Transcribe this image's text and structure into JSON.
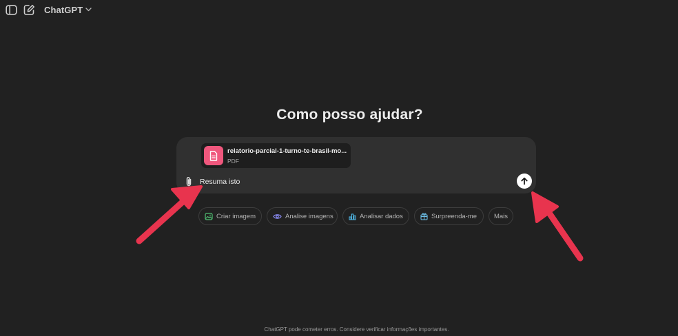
{
  "header": {
    "model_name": "ChatGPT",
    "icons": {
      "sidebar": "sidebar-toggle-icon",
      "new_chat": "new-chat-icon",
      "model_menu": "chevron-down-icon"
    }
  },
  "main": {
    "heading": "Como posso ajudar?"
  },
  "composer": {
    "attachment": {
      "file_name": "relatorio-parcial-1-turno-te-brasil-mo...",
      "file_type": "PDF",
      "icon": "document-icon",
      "icon_color": "#f0577d"
    },
    "input_value": "Resuma isto",
    "attach_icon": "paperclip-icon",
    "send_icon": "arrow-up-icon"
  },
  "suggestions": [
    {
      "label": "Criar imagem",
      "icon": "image-icon",
      "color": "#4fbf72"
    },
    {
      "label": "Analise imagens",
      "icon": "eye-icon",
      "color": "#8b8cf7"
    },
    {
      "label": "Analisar dados",
      "icon": "bar-chart-icon",
      "color": "#4fb7e6"
    },
    {
      "label": "Surpreenda-me",
      "icon": "gift-icon",
      "color": "#6dc0e8"
    },
    {
      "label": "Mais"
    }
  ],
  "footer": {
    "disclaimer": "ChatGPT pode cometer erros. Considere verificar informações importantes."
  },
  "theme": {
    "background": "#212121",
    "composer": "#303030",
    "annotation_arrow": "#e8344e"
  }
}
